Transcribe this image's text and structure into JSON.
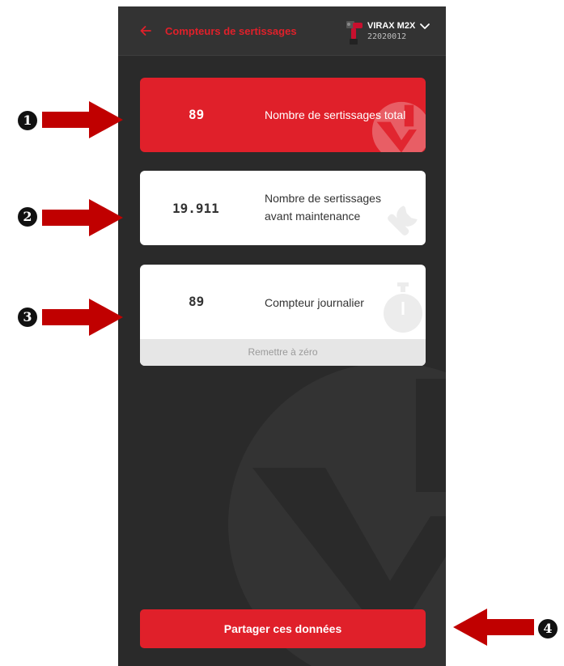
{
  "header": {
    "back_icon": "arrow-left-icon",
    "title": "Compteurs de sertissages",
    "device_name": "VIRAX M2X",
    "device_serial": "22020012",
    "dropdown_icon": "chevron-down-icon"
  },
  "counters": {
    "total": {
      "value": "89",
      "label": "Nombre de sertissages total",
      "icon": "virax-logo-icon"
    },
    "maintenance": {
      "value": "19.911",
      "label": "Nombre de sertissages avant maintenance",
      "icon": "wrench-icon"
    },
    "daily": {
      "value": "89",
      "label": "Compteur journalier",
      "icon": "stopwatch-icon",
      "reset_label": "Remettre à zéro"
    }
  },
  "share_button": "Partager ces données",
  "callouts": [
    "1",
    "2",
    "3",
    "4"
  ],
  "colors": {
    "accent": "#e0202a",
    "background": "#2a2a2a",
    "header": "#333333",
    "card": "#ffffff",
    "annotation_arrow": "#c00000"
  }
}
